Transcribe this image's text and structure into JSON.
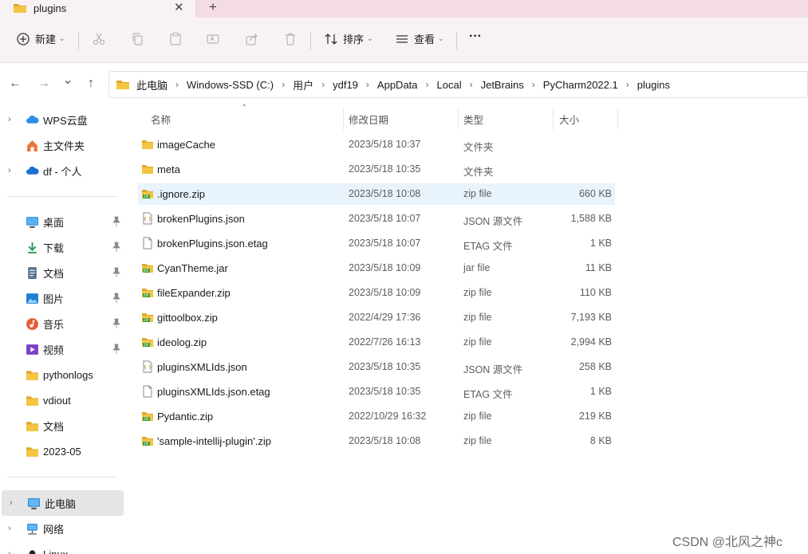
{
  "tab": {
    "title": "plugins",
    "close_glyph": "✕",
    "new_glyph": "+"
  },
  "toolbar": {
    "new_label": "新建",
    "sort_label": "排序",
    "view_label": "查看",
    "more_glyph": "···",
    "icons": [
      "cut-icon",
      "copy-icon",
      "paste-icon",
      "rename-icon",
      "share-icon",
      "delete-icon"
    ]
  },
  "nav": {
    "back_glyph": "←",
    "forward_glyph": "→",
    "recent_glyph": "⌄",
    "up_glyph": "↑",
    "crumb_sep": "›",
    "breadcrumbs": [
      "此电脑",
      "Windows-SSD (C:)",
      "用户",
      "ydf19",
      "AppData",
      "Local",
      "JetBrains",
      "PyCharm2022.1",
      "plugins"
    ]
  },
  "sidebar": {
    "expand_glyph": "›",
    "top": [
      {
        "label": "WPS云盘",
        "icon": "cloud-icon",
        "expand": true
      },
      {
        "label": "主文件夹",
        "icon": "home-icon",
        "expand": false
      },
      {
        "label": "df - 个人",
        "icon": "onedrive-icon",
        "expand": true
      }
    ],
    "pinned": [
      {
        "label": "桌面",
        "icon": "desktop-icon",
        "pinned": true
      },
      {
        "label": "下载",
        "icon": "download-icon",
        "pinned": true
      },
      {
        "label": "文档",
        "icon": "documents-icon",
        "pinned": true
      },
      {
        "label": "图片",
        "icon": "pictures-icon",
        "pinned": true
      },
      {
        "label": "音乐",
        "icon": "music-icon",
        "pinned": true
      },
      {
        "label": "视频",
        "icon": "videos-icon",
        "pinned": true
      },
      {
        "label": "pythonlogs",
        "icon": "folder-icon",
        "pinned": false
      },
      {
        "label": "vdiout",
        "icon": "folder-icon",
        "pinned": false
      },
      {
        "label": "文档",
        "icon": "folder-icon",
        "pinned": false
      },
      {
        "label": "2023-05",
        "icon": "folder-icon",
        "pinned": false
      }
    ],
    "bottom": [
      {
        "label": "此电脑",
        "icon": "this-pc-icon",
        "expand": true,
        "selected": true
      },
      {
        "label": "网络",
        "icon": "network-icon",
        "expand": true,
        "selected": false
      },
      {
        "label": "Linux",
        "icon": "linux-icon",
        "expand": true,
        "selected": false
      }
    ]
  },
  "columns": {
    "name": "名称",
    "date": "修改日期",
    "type": "类型",
    "size": "大小",
    "sort_glyph": "⌃"
  },
  "files": [
    {
      "name": "imageCache",
      "date": "2023/5/18 10:37",
      "type": "文件夹",
      "size": "",
      "icon": "folder-icon"
    },
    {
      "name": "meta",
      "date": "2023/5/18 10:35",
      "type": "文件夹",
      "size": "",
      "icon": "folder-icon"
    },
    {
      "name": ".ignore.zip",
      "date": "2023/5/18 10:08",
      "type": "zip file",
      "size": "660 KB",
      "icon": "zip-icon",
      "selected": true
    },
    {
      "name": "brokenPlugins.json",
      "date": "2023/5/18 10:07",
      "type": "JSON 源文件",
      "size": "1,588 KB",
      "icon": "json-file-icon"
    },
    {
      "name": "brokenPlugins.json.etag",
      "date": "2023/5/18 10:07",
      "type": "ETAG 文件",
      "size": "1 KB",
      "icon": "blank-file-icon"
    },
    {
      "name": "CyanTheme.jar",
      "date": "2023/5/18 10:09",
      "type": "jar file",
      "size": "11 KB",
      "icon": "jar-icon"
    },
    {
      "name": "fileExpander.zip",
      "date": "2023/5/18 10:09",
      "type": "zip file",
      "size": "110 KB",
      "icon": "zip-icon"
    },
    {
      "name": "gittoolbox.zip",
      "date": "2022/4/29 17:36",
      "type": "zip file",
      "size": "7,193 KB",
      "icon": "zip-icon"
    },
    {
      "name": "ideolog.zip",
      "date": "2022/7/26 16:13",
      "type": "zip file",
      "size": "2,994 KB",
      "icon": "zip-icon"
    },
    {
      "name": "pluginsXMLIds.json",
      "date": "2023/5/18 10:35",
      "type": "JSON 源文件",
      "size": "258 KB",
      "icon": "json-file-icon"
    },
    {
      "name": "pluginsXMLIds.json.etag",
      "date": "2023/5/18 10:35",
      "type": "ETAG 文件",
      "size": "1 KB",
      "icon": "blank-file-icon"
    },
    {
      "name": "Pydantic.zip",
      "date": "2022/10/29 16:32",
      "type": "zip file",
      "size": "219 KB",
      "icon": "zip-icon"
    },
    {
      "name": "'sample-intellij-plugin'.zip",
      "date": "2023/5/18 10:08",
      "type": "zip file",
      "size": "8 KB",
      "icon": "zip-icon"
    }
  ],
  "watermark": "CSDN @北风之神c",
  "colors": {
    "folder": "#f4c542",
    "folder_dark": "#e0a82e",
    "selection": "#e8f3fc",
    "zip_green": "#3f9a2f",
    "tab_bg": "#f3dde3",
    "cmd_bg": "#f9f2f5"
  }
}
